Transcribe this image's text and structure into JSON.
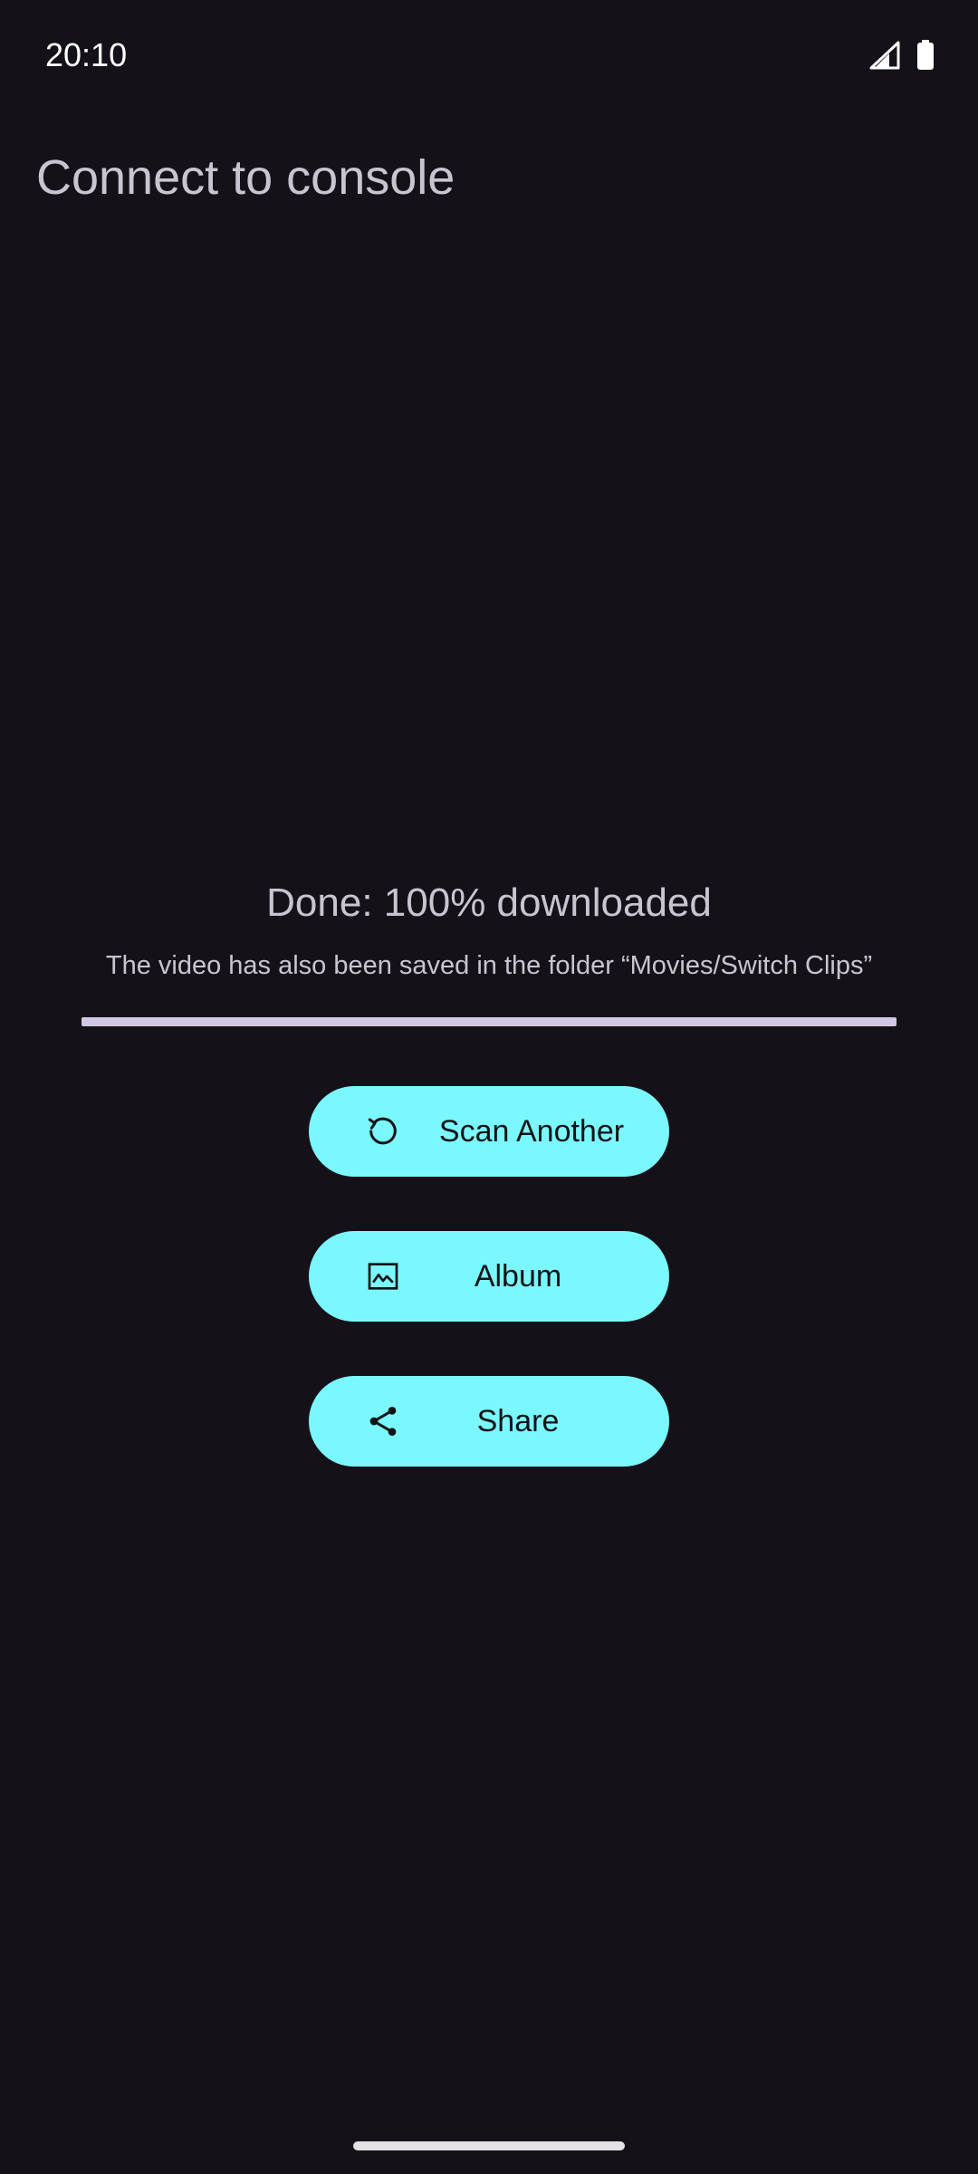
{
  "status_bar": {
    "time": "20:10",
    "icons": [
      "cell-signal-icon",
      "battery-icon"
    ]
  },
  "app_bar": {
    "title": "Connect to console"
  },
  "download": {
    "status": "Done: 100% downloaded",
    "note": "The video has also been saved in the folder “Movies/Switch Clips”",
    "progress_percent": 100
  },
  "actions": {
    "scan_another": {
      "label": "Scan Another",
      "icon": "refresh-icon"
    },
    "album": {
      "label": "Album",
      "icon": "image-icon"
    },
    "share": {
      "label": "Share",
      "icon": "share-icon"
    }
  },
  "colors": {
    "background": "#141218",
    "button": "#7bf8ff",
    "progress": "#d3c7e6",
    "text": "#cac4d0"
  }
}
